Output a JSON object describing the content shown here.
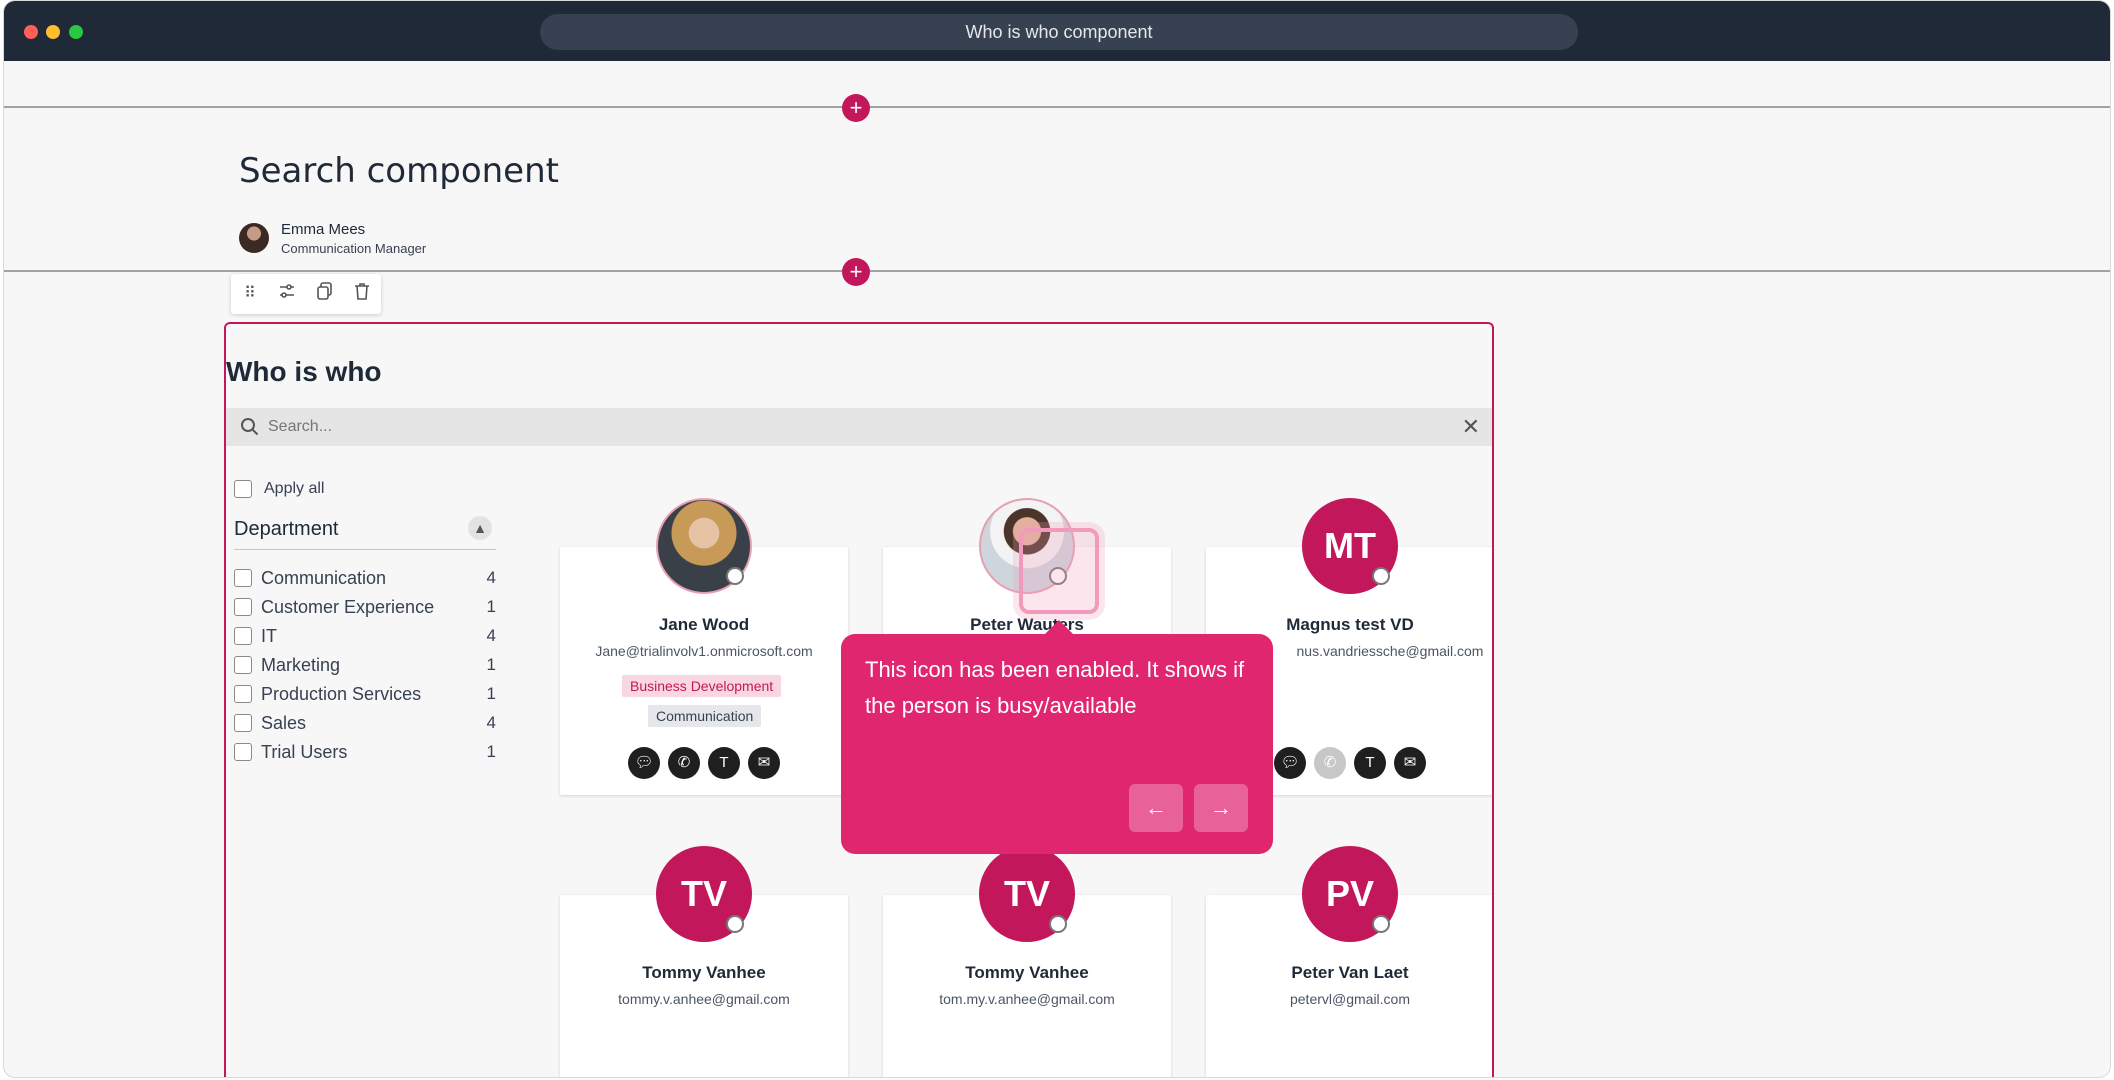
{
  "browser": {
    "title": "Who is who component"
  },
  "page": {
    "title": "Search component",
    "author": {
      "name": "Emma Mees",
      "role": "Communication Manager"
    }
  },
  "toolbar": {
    "icons": [
      "drag-icon",
      "settings-icon",
      "copy-icon",
      "delete-icon"
    ]
  },
  "component": {
    "title": "Who is who",
    "search": {
      "placeholder": "Search..."
    },
    "filters": {
      "apply_all": "Apply all",
      "department_label": "Department",
      "items": [
        {
          "label": "Communication",
          "count": "4"
        },
        {
          "label": "Customer Experience",
          "count": "1"
        },
        {
          "label": "IT",
          "count": "4"
        },
        {
          "label": "Marketing",
          "count": "1"
        },
        {
          "label": "Production Services",
          "count": "1"
        },
        {
          "label": "Sales",
          "count": "4"
        },
        {
          "label": "Trial Users",
          "count": "1"
        }
      ]
    },
    "people": [
      {
        "name": "Jane Wood",
        "email": "Jane@trialinvolv1.onmicrosoft.com",
        "tags": [
          "Business Development",
          "Communication"
        ],
        "avatar": "photo",
        "actions": [
          "chat-icon",
          "phone-icon",
          "teams-icon",
          "mail-icon"
        ]
      },
      {
        "name": "Peter Wauters",
        "email": "",
        "tags": [],
        "avatar": "photo",
        "actions": []
      },
      {
        "name": "Magnus test VD",
        "email": "magnus.vandriessche@gmail.com",
        "email_visible": "nus.vandriessche@gmail.com",
        "initials": "MT",
        "avatar": "initials",
        "actions": [
          "chat-icon",
          "phone-icon",
          "teams-icon",
          "mail-icon"
        ]
      },
      {
        "name": "Tommy Vanhee",
        "email": "tommy.v.anhee@gmail.com",
        "initials": "TV",
        "avatar": "initials"
      },
      {
        "name": "Tommy Vanhee",
        "email": "tom.my.v.anhee@gmail.com",
        "initials": "TV",
        "avatar": "initials"
      },
      {
        "name": "Peter Van Laet",
        "email": "petervl@gmail.com",
        "initials": "PV",
        "avatar": "initials"
      }
    ]
  },
  "tooltip": {
    "text": "This icon has been enabled. It shows if the person is busy/available",
    "prev_icon": "arrow-left-icon",
    "next_icon": "arrow-right-icon"
  },
  "colors": {
    "accent": "#c2185b",
    "tooltip": "#e0266f",
    "titlebar": "#1f2937"
  }
}
